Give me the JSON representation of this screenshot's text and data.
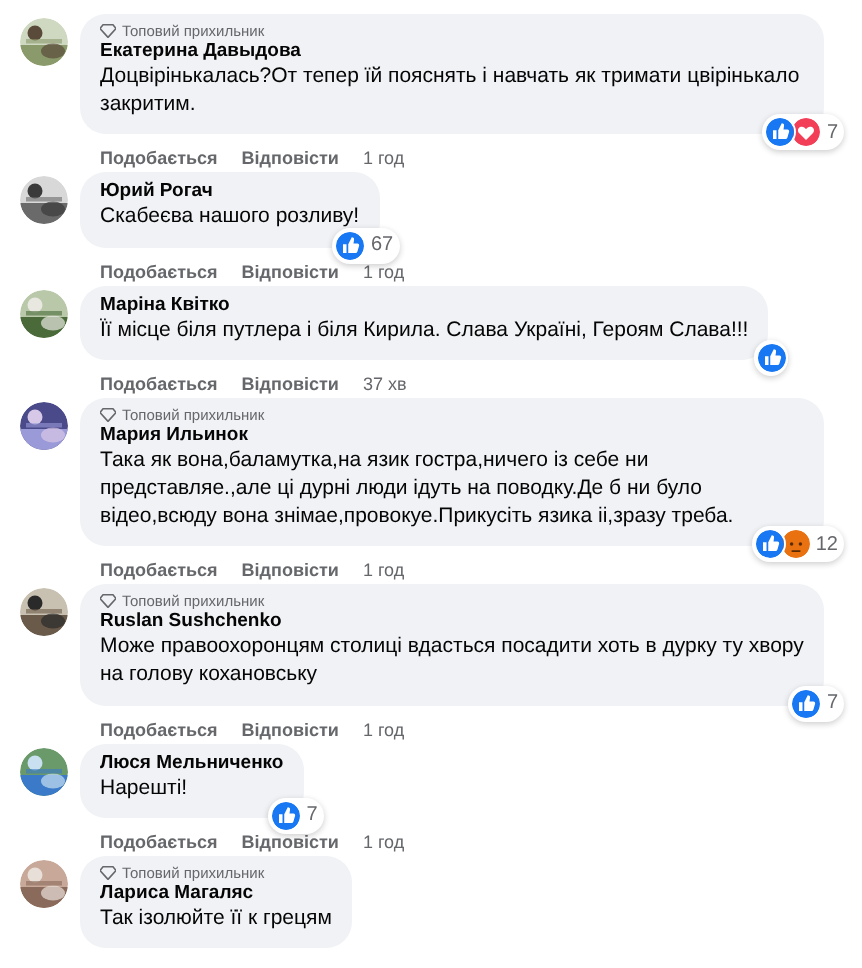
{
  "comments": [
    {
      "badge": "Топовий прихильник",
      "name": "Екатерина Давыдова",
      "text": "Доцвірінькалась?От тепер їй пояснять і навчать як тримати цвірінькало закритим.",
      "reactions": [
        {
          "kind": "like"
        },
        {
          "kind": "love"
        }
      ],
      "reaction_count": "7",
      "actions": [
        "Подобається",
        "Відповісти"
      ],
      "time": "1 год"
    },
    {
      "name": "Юрий Рогач",
      "text": "Скабеєва нашого розливу!",
      "reactions": [
        {
          "kind": "like"
        }
      ],
      "reaction_count": "67",
      "actions": [
        "Подобається",
        "Відповісти"
      ],
      "time": "1 год"
    },
    {
      "name": "Маріна Квітко",
      "text": "Її місце біля путлера і біля Кирила. Слава Україні, Героям Слава!!!",
      "reactions": [
        {
          "kind": "like"
        }
      ],
      "actions": [
        "Подобається",
        "Відповісти"
      ],
      "time": "37 хв"
    },
    {
      "badge": "Топовий прихильник",
      "name": "Мария Ильинок",
      "text": "Така як вона,баламутка,на язик гостра,ничего із себе ни представляе.,але ці дурні люди ідуть на поводку.Де б ни було відео,всюду вона знімае,провокуе.Прикусіть язика іі,зразу треба.",
      "reactions": [
        {
          "kind": "like"
        },
        {
          "kind": "angry"
        }
      ],
      "reaction_count": "12",
      "actions": [
        "Подобається",
        "Відповісти"
      ],
      "time": "1 год"
    },
    {
      "badge": "Топовий прихильник",
      "name": "Ruslan Sushchenko",
      "text": "Може правоохоронцям столиці вдасться посадити хоть в дурку ту хвору на голову кохановську",
      "reactions": [
        {
          "kind": "like"
        }
      ],
      "reaction_count": "7",
      "actions": [
        "Подобається",
        "Відповісти"
      ],
      "time": "1 год"
    },
    {
      "name": "Люся Мельниченко",
      "text": "Нарешті!",
      "reactions": [
        {
          "kind": "like"
        }
      ],
      "reaction_count": "7",
      "actions": [
        "Подобається",
        "Відповісти"
      ],
      "time": "1 год"
    },
    {
      "badge": "Топовий прихильник",
      "name": "Лариса Магаляс",
      "text": "Так ізолюйте її к грецям"
    }
  ]
}
